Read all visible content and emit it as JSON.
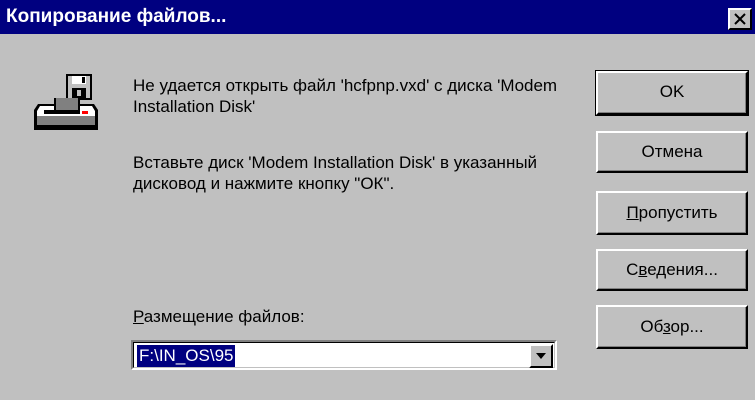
{
  "dialog": {
    "title": "Копирование файлов..."
  },
  "icons": {
    "disk": "floppy-drive-icon",
    "close": "close-icon",
    "dropdown": "chevron-down-icon"
  },
  "message": {
    "line1": "Не удается открыть файл 'hcfpnp.vxd' с диска 'Modem Installation Disk'",
    "line2": "Вставьте диск 'Modem Installation Disk' в указанный дисковод и нажмите кнопку \"ОК\"."
  },
  "location": {
    "label_hotkey": "Р",
    "label_rest": "азмещение файлов:",
    "value": "F:\\IN_OS\\95"
  },
  "buttons": {
    "ok": "OK",
    "cancel": "Отмена",
    "skip_hotkey": "П",
    "skip_rest": "ропустить",
    "details_pre": "С",
    "details_hotkey": "в",
    "details_rest": "едения...",
    "browse_pre": "Об",
    "browse_hotkey": "з",
    "browse_rest": "ор..."
  },
  "colors": {
    "titlebar": "#000080",
    "face": "#c0c0c0",
    "highlight": "#000080"
  }
}
